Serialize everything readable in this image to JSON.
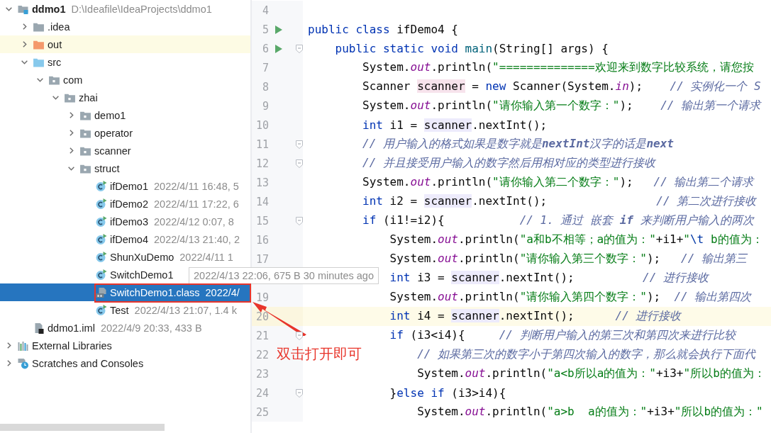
{
  "tree": [
    {
      "label": "ddmo1",
      "meta": "D:\\Ideafile\\IdeaProjects\\ddmo1",
      "kind": "project",
      "expanded": true,
      "selected": false,
      "highlighted": false,
      "children": [
        {
          "label": ".idea",
          "kind": "folder",
          "expanded": false,
          "selected": false,
          "highlighted": false
        },
        {
          "label": "out",
          "kind": "excluded-folder",
          "expanded": false,
          "selected": false,
          "highlighted": true
        },
        {
          "label": "src",
          "kind": "source-folder",
          "expanded": true,
          "selected": false,
          "highlighted": false,
          "children": [
            {
              "label": "com",
              "kind": "package",
              "expanded": true,
              "selected": false,
              "highlighted": false,
              "children": [
                {
                  "label": "zhai",
                  "kind": "package",
                  "expanded": true,
                  "selected": false,
                  "highlighted": false,
                  "children": [
                    {
                      "label": "demo1",
                      "kind": "package",
                      "expanded": false,
                      "selected": false,
                      "highlighted": false
                    },
                    {
                      "label": "operator",
                      "kind": "package",
                      "expanded": false,
                      "selected": false,
                      "highlighted": false
                    },
                    {
                      "label": "scanner",
                      "kind": "package",
                      "expanded": false,
                      "selected": false,
                      "highlighted": false
                    },
                    {
                      "label": "struct",
                      "kind": "package",
                      "expanded": true,
                      "selected": false,
                      "highlighted": false,
                      "children": [
                        {
                          "label": "ifDemo1",
                          "meta": "2022/4/11 16:48, 5",
                          "kind": "class",
                          "selected": false,
                          "highlighted": false
                        },
                        {
                          "label": "ifDemo2",
                          "meta": "2022/4/11 17:22, 6",
                          "kind": "class",
                          "selected": false,
                          "highlighted": false
                        },
                        {
                          "label": "ifDemo3",
                          "meta": "2022/4/12 0:07, 8",
                          "kind": "class",
                          "selected": false,
                          "highlighted": false
                        },
                        {
                          "label": "ifDemo4",
                          "meta": "2022/4/13 21:40, 2",
                          "kind": "class",
                          "selected": false,
                          "highlighted": false
                        },
                        {
                          "label": "ShunXuDemo",
                          "meta": "2022/4/11 1",
                          "kind": "class",
                          "selected": false,
                          "highlighted": false
                        },
                        {
                          "label": "SwitchDemo1",
                          "kind": "class",
                          "selected": false,
                          "highlighted": false
                        },
                        {
                          "label": "SwitchDemo1.class",
                          "meta": "2022/4/",
                          "kind": "classfile",
                          "selected": true,
                          "highlighted": false
                        },
                        {
                          "label": "Test",
                          "meta": "2022/4/13 21:07, 1.4 k",
                          "kind": "class",
                          "selected": false,
                          "highlighted": false
                        }
                      ]
                    }
                  ]
                }
              ]
            }
          ]
        },
        {
          "label": "ddmo1.iml",
          "meta": "2022/4/9 20:33, 433 B",
          "kind": "iml",
          "selected": false,
          "highlighted": false
        }
      ]
    },
    {
      "label": "External Libraries",
      "kind": "libraries",
      "expanded": false,
      "selected": false,
      "highlighted": false
    },
    {
      "label": "Scratches and Consoles",
      "kind": "scratches",
      "expanded": false,
      "selected": false,
      "highlighted": false
    }
  ],
  "tooltip": {
    "text": "2022/4/13 22:06, 675 B 30 minutes ago"
  },
  "annotation": {
    "text": "双击打开即可"
  },
  "code": [
    {
      "n": "4",
      "run": false,
      "fold": false,
      "current": false
    },
    {
      "n": "5",
      "run": true,
      "fold": false,
      "current": false,
      "tokens": [
        {
          "t": "public class",
          "kind": "kw"
        },
        {
          "t": " ifDemo4 {",
          "kind": "plain"
        }
      ]
    },
    {
      "n": "6",
      "run": true,
      "fold": true,
      "current": false,
      "tokens": [
        {
          "t": "    public static void ",
          "kind": "kw"
        },
        {
          "t": "main",
          "kind": "method"
        },
        {
          "t": "(String[] args) {",
          "kind": "plain"
        }
      ]
    },
    {
      "n": "7",
      "run": false,
      "fold": false,
      "current": false,
      "tokens": [
        {
          "t": "        System.",
          "kind": "plain"
        },
        {
          "t": "out",
          "kind": "field"
        },
        {
          "t": ".println(",
          "kind": "plain"
        },
        {
          "t": "\"==============欢迎来到数字比较系统，请您按",
          "kind": "str"
        }
      ]
    },
    {
      "n": "8",
      "run": false,
      "fold": false,
      "current": false,
      "tokens": [
        {
          "t": "        Scanner ",
          "kind": "plain"
        },
        {
          "t": "scanner",
          "kind": "decl"
        },
        {
          "t": " = ",
          "kind": "plain"
        },
        {
          "t": "new",
          "kind": "kw"
        },
        {
          "t": " Scanner(System.",
          "kind": "plain"
        },
        {
          "t": "in",
          "kind": "field"
        },
        {
          "t": ");    ",
          "kind": "plain"
        },
        {
          "t": "// 实例化一个 S",
          "kind": "cmt"
        }
      ]
    },
    {
      "n": "9",
      "run": false,
      "fold": false,
      "current": false,
      "tokens": [
        {
          "t": "        System.",
          "kind": "plain"
        },
        {
          "t": "out",
          "kind": "field"
        },
        {
          "t": ".println(",
          "kind": "plain"
        },
        {
          "t": "\"请你输入第一个数字：\"",
          "kind": "str"
        },
        {
          "t": ");    ",
          "kind": "plain"
        },
        {
          "t": "// 输出第一个请求",
          "kind": "cmt"
        }
      ]
    },
    {
      "n": "10",
      "run": false,
      "fold": false,
      "current": false,
      "tokens": [
        {
          "t": "        int",
          "kind": "kw"
        },
        {
          "t": " i1 = ",
          "kind": "plain"
        },
        {
          "t": "scanner",
          "kind": "usage"
        },
        {
          "t": ".nextInt();",
          "kind": "plain"
        }
      ]
    },
    {
      "n": "11",
      "run": false,
      "fold": true,
      "current": false,
      "tokens": [
        {
          "t": "        // 用户输入的格式如果是数字就是**nextInt**汉字的话是**next**",
          "kind": "cmt"
        }
      ]
    },
    {
      "n": "12",
      "run": false,
      "fold": true,
      "current": false,
      "tokens": [
        {
          "t": "        // 并且接受用户输入的数字然后用相对应的类型进行接收",
          "kind": "cmt"
        }
      ]
    },
    {
      "n": "13",
      "run": false,
      "fold": false,
      "current": false,
      "tokens": [
        {
          "t": "        System.",
          "kind": "plain"
        },
        {
          "t": "out",
          "kind": "field"
        },
        {
          "t": ".println(",
          "kind": "plain"
        },
        {
          "t": "\"请你输入第二个数字：\"",
          "kind": "str"
        },
        {
          "t": ");   ",
          "kind": "plain"
        },
        {
          "t": "// 输出第二个请求",
          "kind": "cmt"
        }
      ]
    },
    {
      "n": "14",
      "run": false,
      "fold": false,
      "current": false,
      "tokens": [
        {
          "t": "        int",
          "kind": "kw"
        },
        {
          "t": " i2 = ",
          "kind": "plain"
        },
        {
          "t": "scanner",
          "kind": "usage"
        },
        {
          "t": ".nextInt();                ",
          "kind": "plain"
        },
        {
          "t": "// 第二次进行接收",
          "kind": "cmt"
        }
      ]
    },
    {
      "n": "15",
      "run": false,
      "fold": true,
      "current": false,
      "tokens": [
        {
          "t": "        if",
          "kind": "kw"
        },
        {
          "t": " (i1!=i2){           ",
          "kind": "plain"
        },
        {
          "t": "// 1. 通过 嵌套 **if** 来判断用户输入的两次",
          "kind": "cmt"
        }
      ]
    },
    {
      "n": "16",
      "run": false,
      "fold": false,
      "current": false,
      "tokens": [
        {
          "t": "            System.",
          "kind": "plain"
        },
        {
          "t": "out",
          "kind": "field"
        },
        {
          "t": ".println(",
          "kind": "plain"
        },
        {
          "t": "\"a和b不相等；a的值为：\"",
          "kind": "str"
        },
        {
          "t": "+i1+",
          "kind": "plain"
        },
        {
          "t": "\"",
          "kind": "str"
        },
        {
          "t": "\\t",
          "kind": "esc"
        },
        {
          "t": " b的值为：",
          "kind": "str"
        }
      ]
    },
    {
      "n": "17",
      "run": false,
      "fold": false,
      "current": false,
      "tokens": [
        {
          "t": "            System.",
          "kind": "plain"
        },
        {
          "t": "out",
          "kind": "field"
        },
        {
          "t": ".println(",
          "kind": "plain"
        },
        {
          "t": "\"请你输入第三个数字：\"",
          "kind": "str"
        },
        {
          "t": ");   ",
          "kind": "plain"
        },
        {
          "t": "// 输出第三",
          "kind": "cmt"
        }
      ]
    },
    {
      "run": false,
      "fold": false,
      "current": false,
      "tokens": [
        {
          "t": "            int",
          "kind": "kw"
        },
        {
          "t": " i3 = ",
          "kind": "plain"
        },
        {
          "t": "scanner",
          "kind": "usage"
        },
        {
          "t": ".nextInt();          ",
          "kind": "plain"
        },
        {
          "t": "// 进行接收",
          "kind": "cmt"
        }
      ]
    },
    {
      "n": "19",
      "run": false,
      "fold": false,
      "current": false,
      "tokens": [
        {
          "t": "            System.",
          "kind": "plain"
        },
        {
          "t": "out",
          "kind": "field"
        },
        {
          "t": ".println(",
          "kind": "plain"
        },
        {
          "t": "\"请你输入第四个数字：\"",
          "kind": "str"
        },
        {
          "t": ");  ",
          "kind": "plain"
        },
        {
          "t": "// 输出第四次",
          "kind": "cmt"
        }
      ]
    },
    {
      "n": "20",
      "run": false,
      "fold": false,
      "current": true,
      "tokens": [
        {
          "t": "            int",
          "kind": "kw"
        },
        {
          "t": " i4 = ",
          "kind": "plain"
        },
        {
          "t": "scanner",
          "kind": "usage"
        },
        {
          "t": ".nextInt();      ",
          "kind": "plain"
        },
        {
          "t": "// 进行接收",
          "kind": "cmt"
        }
      ]
    },
    {
      "n": "21",
      "run": false,
      "fold": true,
      "current": false,
      "tokens": [
        {
          "t": "            if",
          "kind": "kw"
        },
        {
          "t": " (i3<i4){     ",
          "kind": "plain"
        },
        {
          "t": "// 判断用户输入的第三次和第四次来进行比较",
          "kind": "cmt"
        }
      ]
    },
    {
      "n": "22",
      "run": false,
      "fold": false,
      "current": false,
      "tokens": [
        {
          "t": "                // 如果第三次的数字小于第四次输入的数字，那么就会执行下面代",
          "kind": "cmt"
        }
      ]
    },
    {
      "n": "23",
      "run": false,
      "fold": false,
      "current": false,
      "tokens": [
        {
          "t": "                System.",
          "kind": "plain"
        },
        {
          "t": "out",
          "kind": "field"
        },
        {
          "t": ".println(",
          "kind": "plain"
        },
        {
          "t": "\"a<b所以a的值为：\"",
          "kind": "str"
        },
        {
          "t": "+i3+",
          "kind": "plain"
        },
        {
          "t": "\"所以b的值为：",
          "kind": "str"
        }
      ]
    },
    {
      "n": "24",
      "run": false,
      "fold": true,
      "current": false,
      "tokens": [
        {
          "t": "            }",
          "kind": "plain"
        },
        {
          "t": "else if",
          "kind": "kw"
        },
        {
          "t": " (i3>i4){",
          "kind": "plain"
        }
      ]
    },
    {
      "n": "25",
      "run": false,
      "fold": false,
      "current": false,
      "tokens": [
        {
          "t": "                System.",
          "kind": "plain"
        },
        {
          "t": "out",
          "kind": "field"
        },
        {
          "t": ".println(",
          "kind": "plain"
        },
        {
          "t": "\"a>b  a的值为：\"",
          "kind": "str"
        },
        {
          "t": "+i3+",
          "kind": "plain"
        },
        {
          "t": "\"所以b的值为：\"",
          "kind": "str"
        }
      ]
    }
  ]
}
